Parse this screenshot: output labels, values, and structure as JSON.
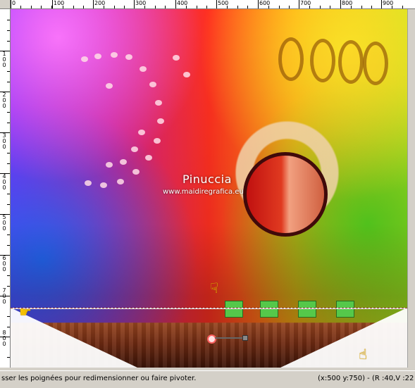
{
  "ruler": {
    "h_labels": [
      "0",
      "100",
      "200",
      "300",
      "400",
      "500",
      "600",
      "700",
      "800",
      "900"
    ],
    "v_labels": [
      "1\n0\n0",
      "2\n0\n0",
      "3\n0\n0",
      "4\n0\n0",
      "5\n0\n0",
      "6\n0\n0",
      "7\n0\n0",
      "8\n0\n0"
    ]
  },
  "canvas": {
    "watermark_title": "Pinuccia",
    "watermark_url": "www.maidiregrafica.eu"
  },
  "status_bar": {
    "message": "sser les poignées pour redimensionner ou faire pivoter.",
    "coords": "(x:500 y:750) - (R :40,V :22"
  },
  "icons": {
    "pointer": "pointing-hand-icon",
    "handle": "pick-handle-icon"
  },
  "colors": {
    "accent_hand": "#f4c000",
    "status_bg": "#d4d0c8"
  }
}
